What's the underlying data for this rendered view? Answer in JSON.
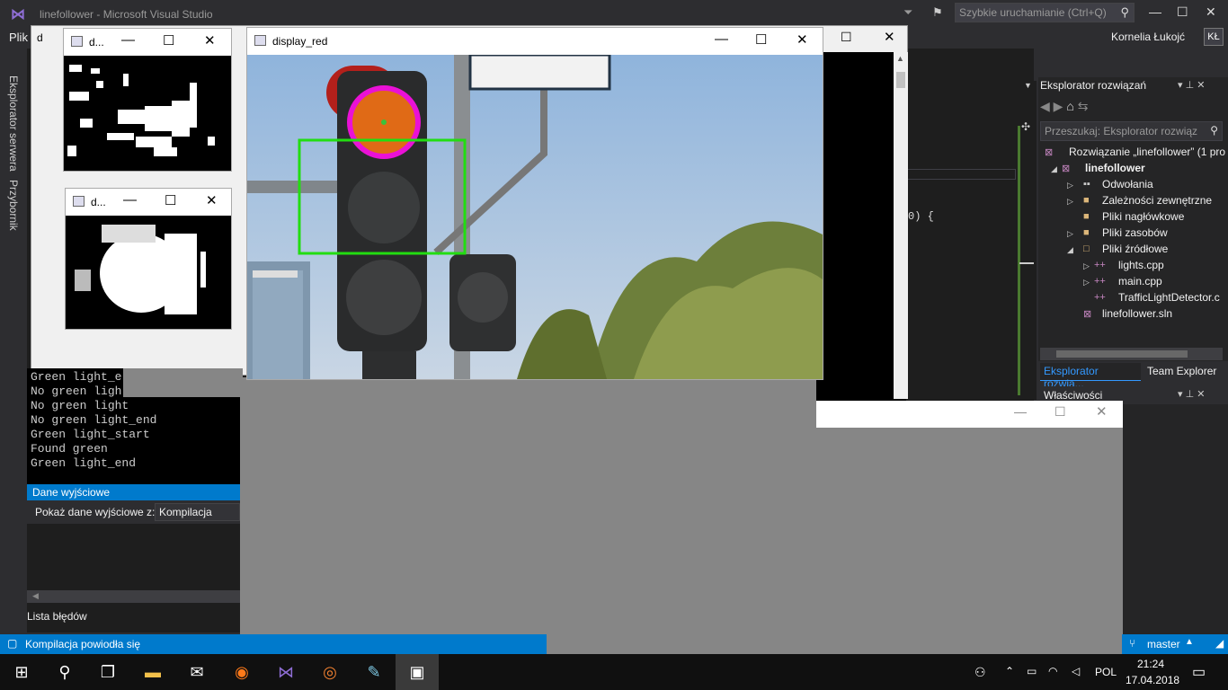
{
  "vs": {
    "title": "linefollower - Microsoft Visual Studio",
    "quick_launch": "Szybkie uruchamianie (Ctrl+Q)",
    "menu_first": "Plik",
    "user": "Kornelia Łukojć",
    "user_initials": "KŁ",
    "left_tab_server": "Eksplorator serwera",
    "left_tab_toolbox": "Przybornik",
    "code_fragment": "0) {"
  },
  "solution_explorer": {
    "title": "Eksplorator rozwiązań",
    "search_placeholder": "Przeszukaj: Eksplorator rozwiąz",
    "items": [
      {
        "label": "Rozwiązanie „linefollower” (1 pro",
        "level": 0,
        "bold": false
      },
      {
        "label": "linefollower",
        "level": 1,
        "bold": true
      },
      {
        "label": "Odwołania",
        "level": 2
      },
      {
        "label": "Zależności zewnętrzne",
        "level": 2
      },
      {
        "label": "Pliki nagłówkowe",
        "level": 2
      },
      {
        "label": "Pliki zasobów",
        "level": 2
      },
      {
        "label": "Pliki źródłowe",
        "level": 2
      },
      {
        "label": "lights.cpp",
        "level": 3
      },
      {
        "label": "main.cpp",
        "level": 3
      },
      {
        "label": "TrafficLightDetector.c",
        "level": 3
      },
      {
        "label": "linefollower.sln",
        "level": 2
      }
    ],
    "tab_active": "Eksplorator rozwią...",
    "tab_other": "Team Explorer"
  },
  "properties": {
    "title": "Właściwości"
  },
  "console": {
    "lines": [
      "Green light_e",
      "No green ligh",
      "No green light",
      "No green light_end",
      "Green light_start",
      "Found green",
      "Green light_end"
    ]
  },
  "output": {
    "title": "Dane wyjściowe",
    "show_label": "Pokaż dane wyjściowe z:",
    "source": "Kompilacja"
  },
  "error_list": "Lista błędów",
  "status": {
    "text": "Kompilacja powiodła się",
    "branch": "master"
  },
  "windows": {
    "small1_title": "d...",
    "small2_title": "d...",
    "main_title": "display_red",
    "back_title": "d"
  },
  "taskbar": {
    "lang": "POL",
    "time": "21:24",
    "date": "17.04.2018"
  }
}
